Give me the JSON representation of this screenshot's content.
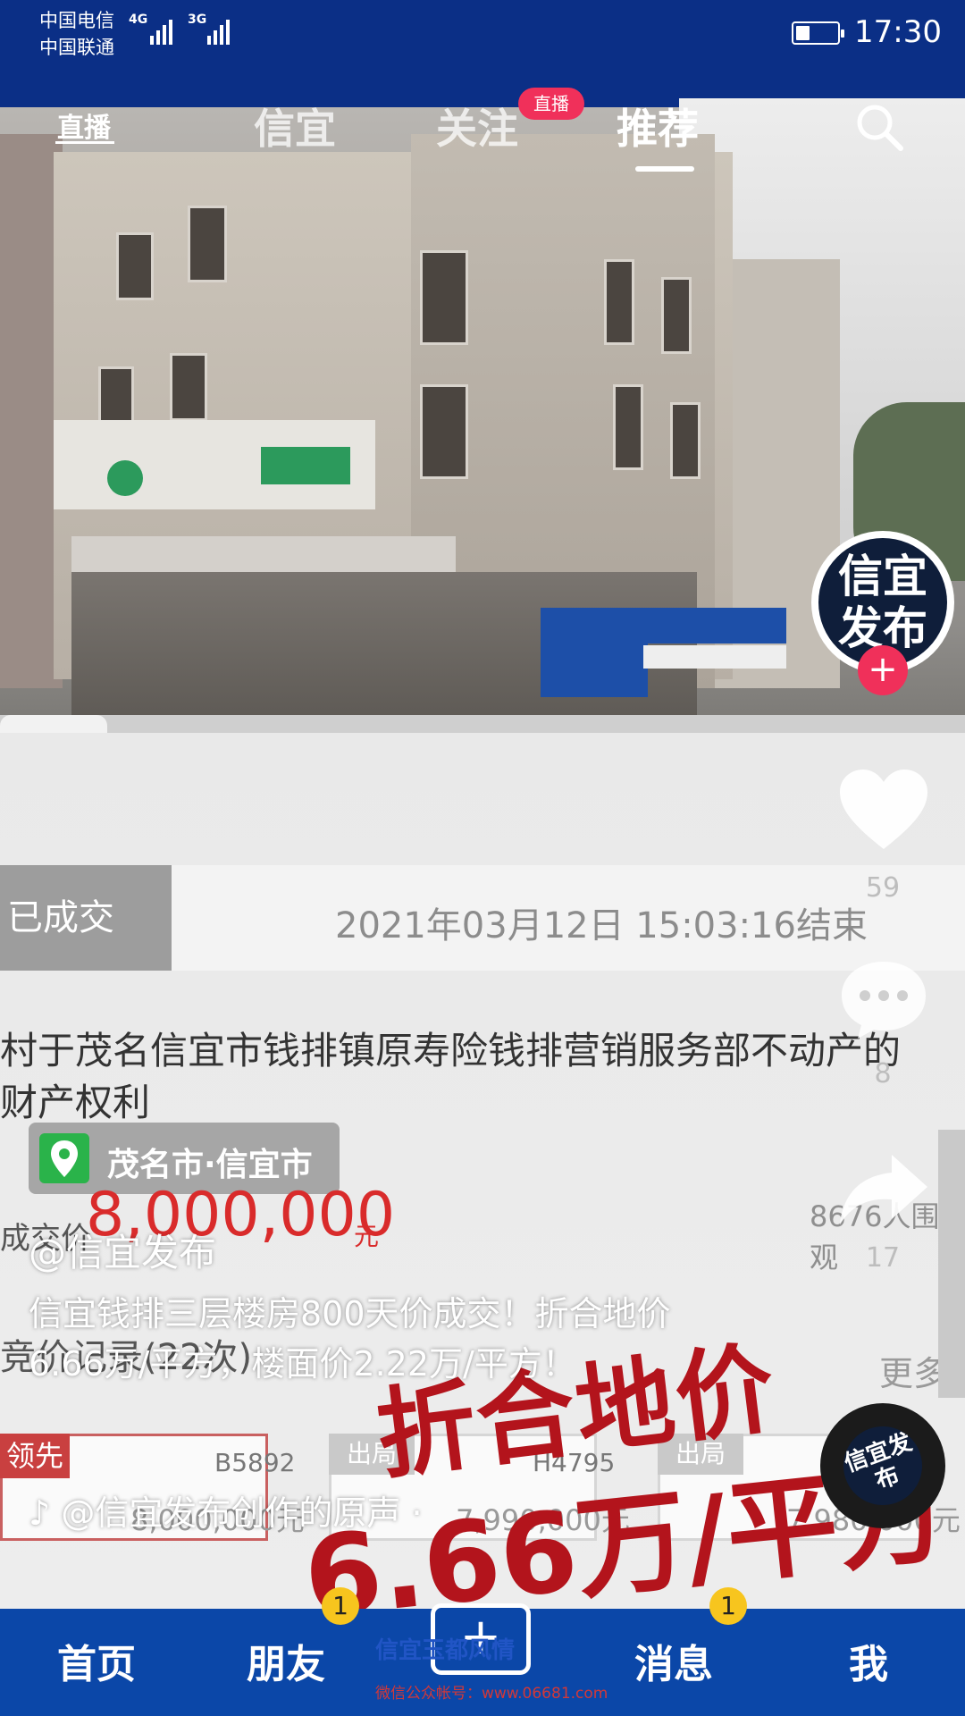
{
  "status_bar": {
    "carrier_1": "中国电信",
    "carrier_2": "中国联通",
    "network_1": "4G",
    "network_2": "3G",
    "time": "17:30",
    "battery_level": 0.35
  },
  "top_nav": {
    "live_label": "直播",
    "tabs": [
      {
        "label": "信宜"
      },
      {
        "label": "关注",
        "badge": "直播"
      },
      {
        "label": "推荐",
        "active": true
      }
    ]
  },
  "auction": {
    "status": "已成交",
    "end_time": "2021年03月12日 15:03:16结束",
    "title_line1": "村于茂名信宜市钱排镇原寿险钱排营销服务部不动产的",
    "title_line2": "财产权利",
    "location": "茂名市·信宜市",
    "price_label": "成交价",
    "price": "8,000,000",
    "price_unit": "元",
    "views": "8676人围观",
    "records_label": "竞价记录(22次)",
    "more_label": "更多",
    "bids": [
      {
        "tag": "领先",
        "id": "B5892",
        "amount": "8,000,000元"
      },
      {
        "tag": "出局",
        "id": "H4795",
        "amount": "7,990,000元"
      },
      {
        "tag": "出局",
        "id": "A97",
        "amount": "7,980,000元"
      }
    ]
  },
  "overlay": {
    "author": "@信宜发布",
    "description": "信宜钱排三层楼房800天价成交！折合地价6.66万/平方，楼面价2.22万/平方！",
    "music": "@信宜发布创作的原声 ·",
    "banner_line1": "折合地价",
    "banner_line2": "6.66万/平方"
  },
  "side_actions": {
    "avatar_text": "信宜发布",
    "likes": "59",
    "comments": "8",
    "shares": "17",
    "disc_text": "信宜发布"
  },
  "bottom_nav": {
    "items": [
      {
        "label": "首页",
        "badge": ""
      },
      {
        "label": "朋友",
        "badge": "1"
      },
      {
        "label": "+",
        "badge": ""
      },
      {
        "label": "消息",
        "badge": "1"
      },
      {
        "label": "我",
        "badge": ""
      }
    ],
    "watermark": "信宜玉都风情",
    "watermark_sub": "微信公众帐号：www.06681.com"
  },
  "colors": {
    "brand_blue": "#0b47a8",
    "live_pink": "#f0305a",
    "price_red": "#d92b2b",
    "banner_red": "#b3141c",
    "badge_yellow": "#f7c51e"
  }
}
